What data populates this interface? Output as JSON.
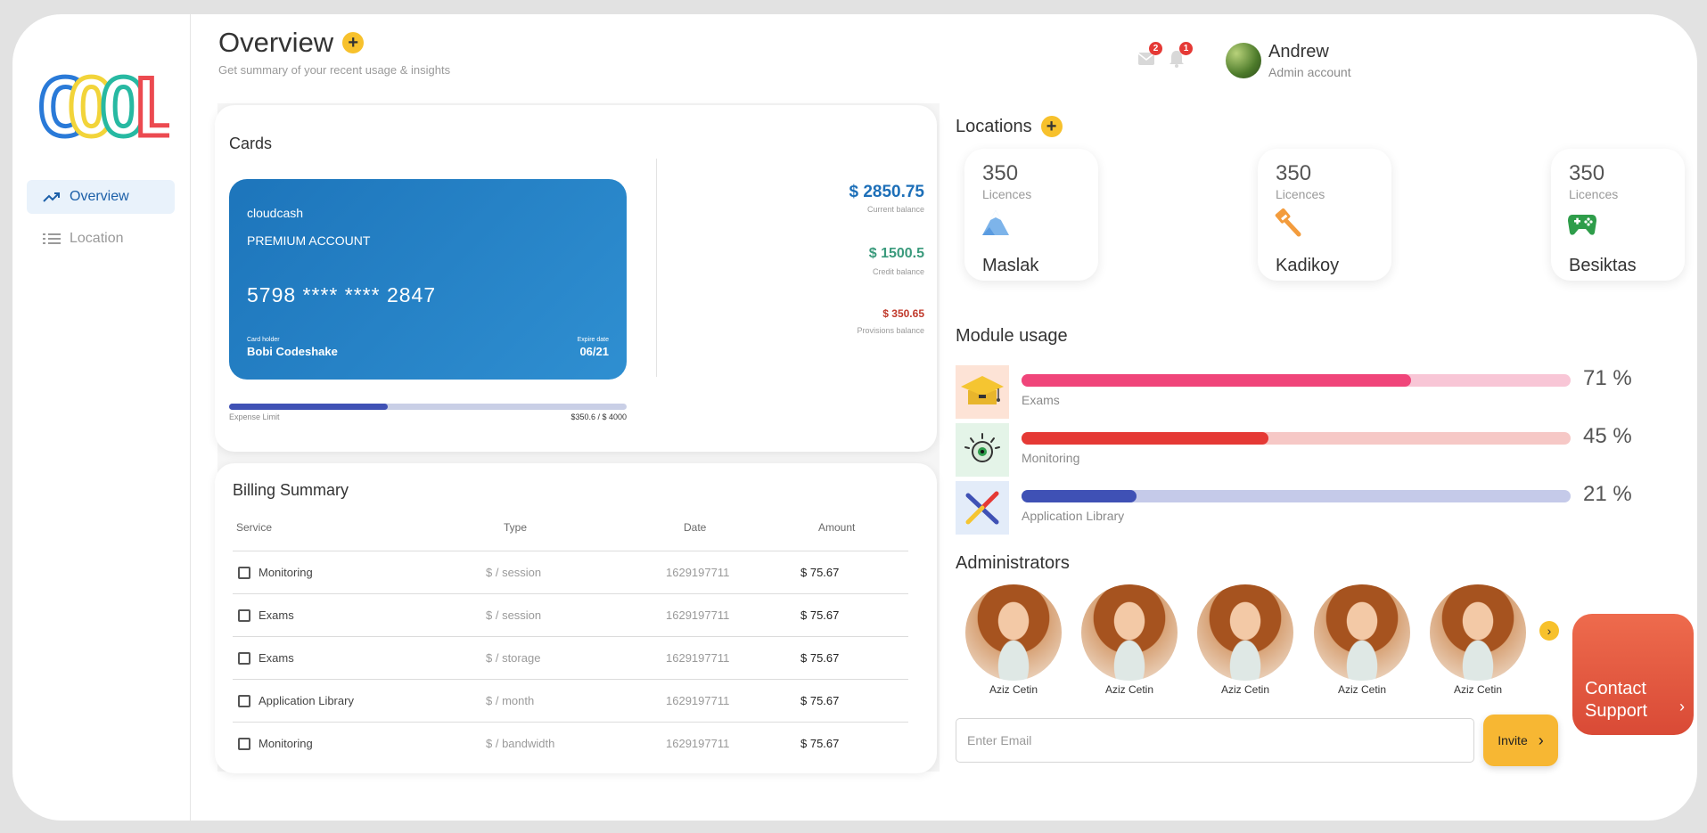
{
  "sidebar": {
    "logo_text": "COOL",
    "items": [
      {
        "label": "Overview",
        "icon": "trending-up-icon",
        "active": true
      },
      {
        "label": "Location",
        "icon": "list-icon",
        "active": false
      }
    ]
  },
  "header": {
    "title": "Overview",
    "subtitle": "Get summary of your recent usage & insights",
    "mail_badge": "2",
    "bell_badge": "1",
    "user_name": "Andrew",
    "user_role": "Admin account"
  },
  "cards": {
    "title": "Cards",
    "bank": "cloudcash",
    "account_type": "PREMIUM ACCOUNT",
    "number": "5798 **** **** 2847",
    "holder_label": "Card holder",
    "holder": "Bobi Codeshake",
    "expire_label": "Expire date",
    "expire": "06/21",
    "balances": [
      {
        "amount": "$ 2850.75",
        "label": "Current balance",
        "color": "#1d6fb8"
      },
      {
        "amount": "$ 1500.5",
        "label": "Credit balance",
        "color": "#3a9a7c"
      },
      {
        "amount": "$ 350.65",
        "label": "Provisions balance",
        "color": "#c0392b"
      }
    ],
    "limit_label": "Expense Limit",
    "limit_value": "$350.6 / $ 4000",
    "limit_fraction": 0.4
  },
  "billing": {
    "title": "Billing Summary",
    "headers": [
      "Service",
      "Type",
      "Date",
      "Amount"
    ],
    "rows": [
      [
        "Monitoring",
        "$ / session",
        "1629197711",
        "$ 75.67"
      ],
      [
        "Exams",
        "$ / session",
        "1629197711",
        "$ 75.67"
      ],
      [
        "Exams",
        "$ / storage",
        "1629197711",
        "$ 75.67"
      ],
      [
        "Application Library",
        "$ / month",
        "1629197711",
        "$ 75.67"
      ],
      [
        "Monitoring",
        "$ / bandwidth",
        "1629197711",
        "$ 75.67"
      ]
    ]
  },
  "locations": {
    "title": "Locations",
    "items": [
      {
        "count": "350",
        "unit": "Licences",
        "name": "Maslak",
        "icon": "mountain-icon"
      },
      {
        "count": "350",
        "unit": "Licences",
        "name": "Kadikoy",
        "icon": "brush-icon"
      },
      {
        "count": "350",
        "unit": "Licences",
        "name": "Besiktas",
        "icon": "gamepad-icon"
      }
    ]
  },
  "modules": {
    "title": "Module usage",
    "items": [
      {
        "label": "Exams",
        "percent": 71,
        "percent_text": "71 %",
        "icon": "graduation-cap-icon",
        "fill": "#f0457a",
        "track": "#f8c6d6"
      },
      {
        "label": "Monitoring",
        "percent": 45,
        "percent_text": "45 %",
        "icon": "eye-icon",
        "fill": "#e53935",
        "track": "#f6c8c6"
      },
      {
        "label": "Application Library",
        "percent": 21,
        "percent_text": "21 %",
        "icon": "x-shape-icon",
        "fill": "#3f51b5",
        "track": "#c5cae9"
      }
    ]
  },
  "administrators": {
    "title": "Administrators",
    "people": [
      "Aziz Cetin",
      "Aziz Cetin",
      "Aziz Cetin",
      "Aziz Cetin",
      "Aziz Cetin"
    ]
  },
  "invite": {
    "placeholder": "Enter Email",
    "button_label": "Invite"
  },
  "contact": {
    "label": "Contact Support"
  }
}
